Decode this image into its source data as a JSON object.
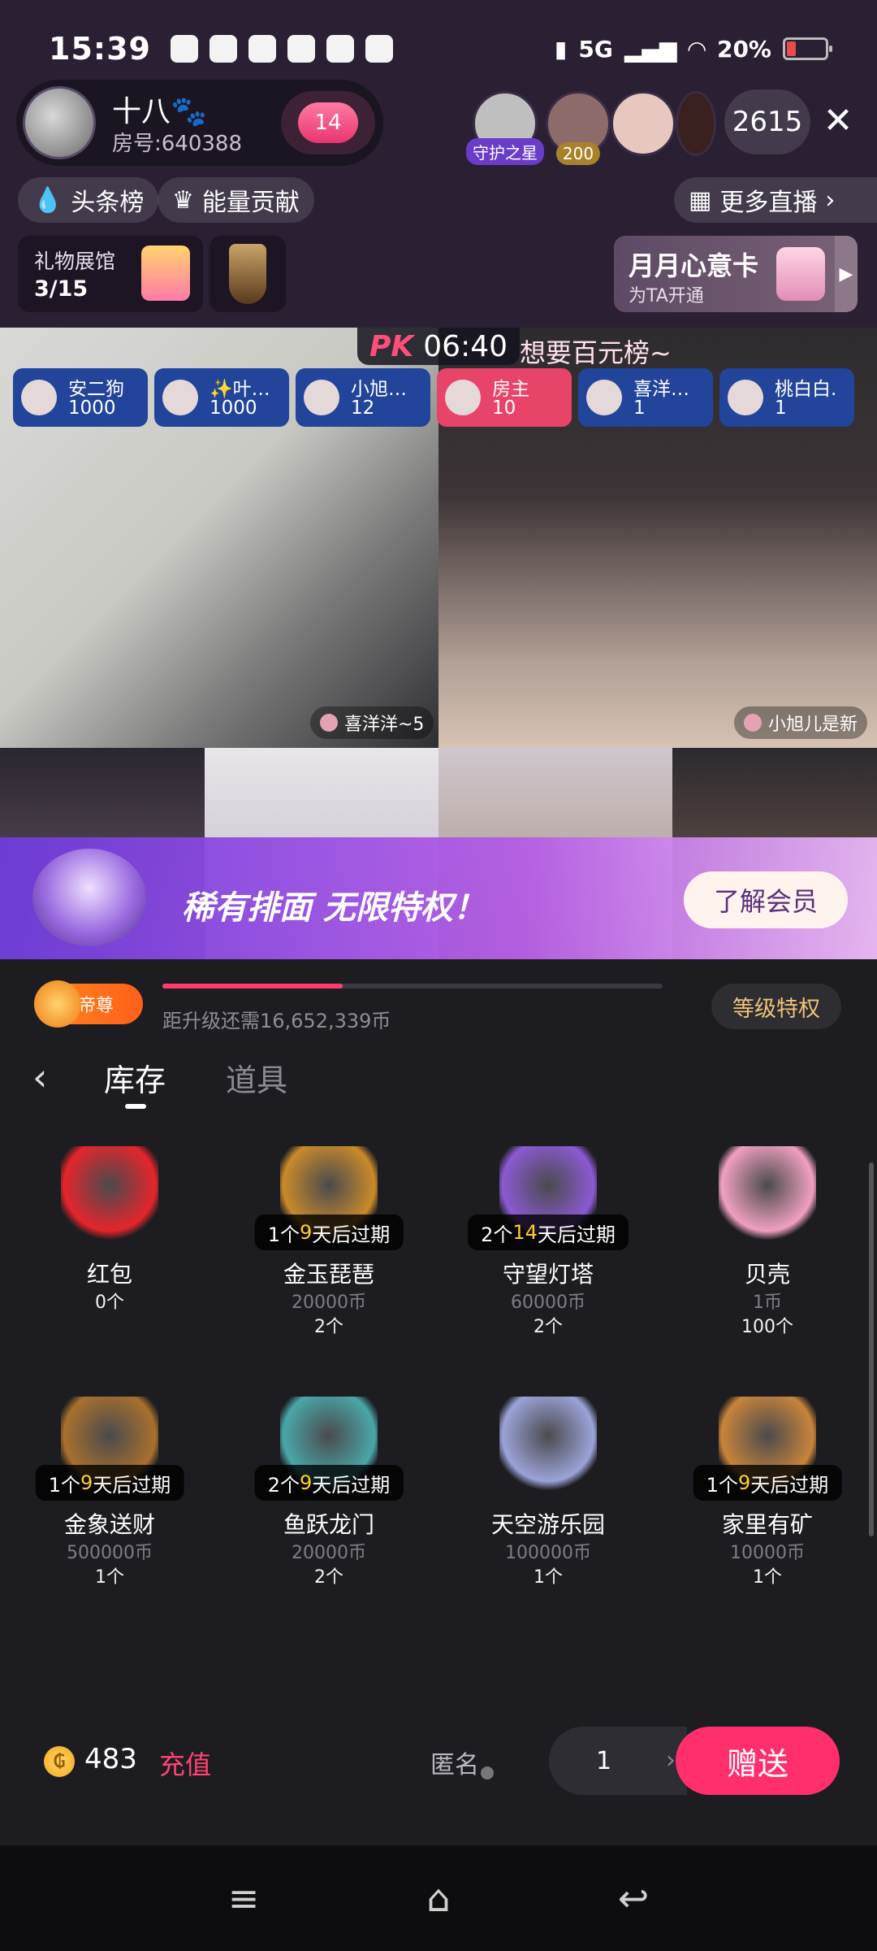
{
  "status_bar": {
    "time": "15:39",
    "battery": "20%",
    "network": "5G"
  },
  "host": {
    "name": "十八🐾",
    "room": "房号:640388",
    "heart_level": "14"
  },
  "viewers": [
    {
      "tag": "守护之星",
      "avatar_color": "#bfbfbf"
    },
    {
      "tag": "200",
      "avatar_color": "#8d6b6b"
    },
    {
      "tag": "",
      "avatar_color": "#e8c7c0"
    },
    {
      "tag": "",
      "avatar_color": "#3b2020"
    }
  ],
  "viewer_count": "2615",
  "chips": {
    "headline": "头条榜",
    "energy": "能量贡献",
    "more_live": "更多直播"
  },
  "gift_hall": {
    "title": "礼物展馆",
    "progress": "3/15"
  },
  "vip_card": {
    "title": "月月心意卡",
    "subtitle": "为TA开通"
  },
  "pk": {
    "label": "PK",
    "timer": "06:40",
    "banner": "想要百元榜~",
    "ranks": [
      {
        "name": "安二狗",
        "score": "1000",
        "host": false
      },
      {
        "name": "✨叶…",
        "score": "1000",
        "host": false
      },
      {
        "name": "小旭…",
        "score": "12",
        "host": false
      },
      {
        "name": "房主",
        "score": "10",
        "host": true
      },
      {
        "name": "喜洋…",
        "score": "1",
        "host": false
      },
      {
        "name": "桃白白.",
        "score": "1",
        "host": false
      }
    ],
    "left_cam": "喜洋洋~5",
    "right_cam": "小旭儿是新"
  },
  "membership": {
    "slogan": "稀有排面 无限特权！",
    "button": "了解会员"
  },
  "level": {
    "badge": "帝尊",
    "progress_fraction": 0.36,
    "note": "距升级还需16,652,339币",
    "privilege": "等级特权"
  },
  "tabs": {
    "active": "库存",
    "inactive": "道具"
  },
  "gifts": [
    {
      "name": "红包",
      "price": "",
      "count": "0个",
      "expiry_pre": "",
      "expiry_hl": "",
      "expiry_post": "",
      "color": "#e5252c"
    },
    {
      "name": "金玉琵琶",
      "price": "20000币",
      "count": "2个",
      "expiry_pre": "1个",
      "expiry_hl": "9",
      "expiry_post": "天后过期",
      "color": "#c98a2a"
    },
    {
      "name": "守望灯塔",
      "price": "60000币",
      "count": "2个",
      "expiry_pre": "2个",
      "expiry_hl": "14",
      "expiry_post": "天后过期",
      "color": "#8b5ad2"
    },
    {
      "name": "贝壳",
      "price": "1币",
      "count": "100个",
      "expiry_pre": "",
      "expiry_hl": "",
      "expiry_post": "",
      "color": "#f0a0c0"
    },
    {
      "name": "金象送财",
      "price": "500000币",
      "count": "1个",
      "expiry_pre": "1个",
      "expiry_hl": "9",
      "expiry_post": "天后过期",
      "color": "#a8702e"
    },
    {
      "name": "鱼跃龙门",
      "price": "20000币",
      "count": "2个",
      "expiry_pre": "2个",
      "expiry_hl": "9",
      "expiry_post": "天后过期",
      "color": "#4aa6a8"
    },
    {
      "name": "天空游乐园",
      "price": "100000币",
      "count": "1个",
      "expiry_pre": "",
      "expiry_hl": "",
      "expiry_post": "",
      "color": "#9ba3d8"
    },
    {
      "name": "家里有矿",
      "price": "10000币",
      "count": "1个",
      "expiry_pre": "1个",
      "expiry_hl": "9",
      "expiry_post": "天后过期",
      "color": "#c8843a"
    }
  ],
  "bottom": {
    "balance": "483",
    "recharge": "充值",
    "anonymous": "匿名",
    "quantity": "1",
    "send": "赠送"
  }
}
